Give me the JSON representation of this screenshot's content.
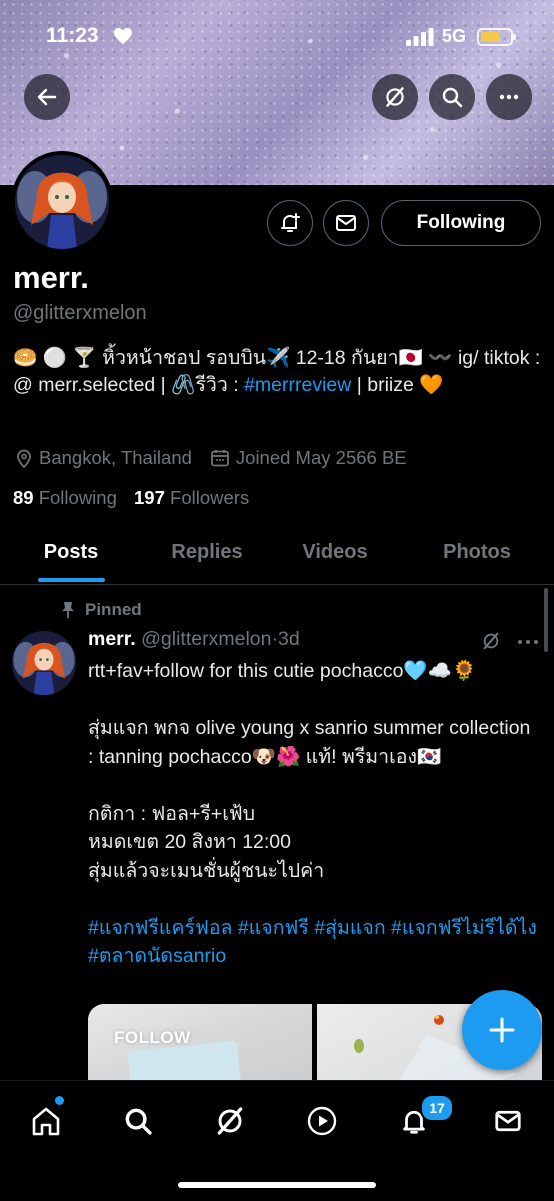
{
  "status_bar": {
    "time": "11:23",
    "network": "5G"
  },
  "profile": {
    "name": "merr.",
    "handle": "@glitterxmelon",
    "bio": {
      "prefix": "🥯 ⚪️ 🍸 หิ้วหน้าชอป รอบบิน✈️ 12-18 กันยา🇯🇵 〰️ ig/ tiktok : @ merr.selected | 🖇️รีวิว : ",
      "hashtag": "#merrreview",
      "suffix": " | briize 🧡"
    },
    "location": "Bangkok, Thailand",
    "joined": "Joined May 2566 BE",
    "following_count": "89",
    "following_label": "Following",
    "followers_count": "197",
    "followers_label": "Followers",
    "follow_button_label": "Following"
  },
  "tabs": [
    {
      "label": "Posts",
      "active": true
    },
    {
      "label": "Replies",
      "active": false
    },
    {
      "label": "Videos",
      "active": false
    },
    {
      "label": "Photos",
      "active": false
    }
  ],
  "post": {
    "pinned_label": "Pinned",
    "author_name": "merr.",
    "author_handle": "@glitterxmelon",
    "separator": "·",
    "time": "3d",
    "lines": [
      "rtt+fav+follow for this cutie pochacco🩵☁️🌻",
      "สุ่มแจก พกจ olive young x sanrio summer collection : tanning pochacco🐶🌺 แท้! พรีมาเอง🇰🇷",
      "กติกา : ฟอล+รี+เฟ้บ",
      "หมดเขต 20 สิงหา 12:00",
      "สุ่มแล้วจะเมนชั่นผู้ชนะไปค่า"
    ],
    "hashtags": "#แจกฟรีแคร์ฟอล #แจกฟรี #สุ่มแจก #แจกฟรีไม่รีได้ไง #ตลาดนัดsanrio",
    "image_caption": "FOLLOW"
  },
  "bottom_nav": {
    "notifications_badge": "17"
  },
  "colors": {
    "accent": "#1d9bf0",
    "background": "#000000",
    "muted": "#71767b"
  }
}
